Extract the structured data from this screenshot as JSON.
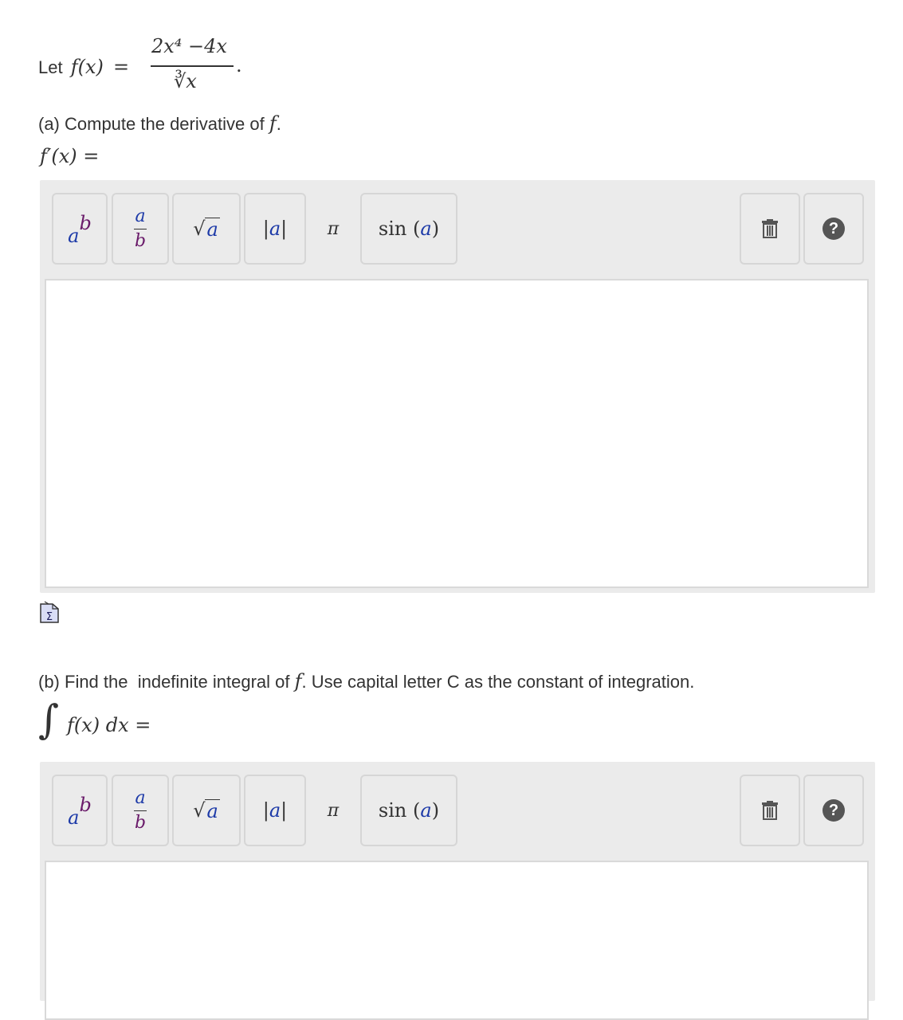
{
  "problem": {
    "let_label": "Let",
    "f_of_x": "f(x)",
    "equals": "=",
    "numerator": "2x⁴ −4x",
    "denominator": "∛x",
    "period": "."
  },
  "part_a": {
    "prompt_prefix": "(a) Compute the derivative of",
    "prompt_var": "f",
    "prompt_suffix": ".",
    "answer_label": "f′(x) ="
  },
  "part_b": {
    "prompt_prefix": "(b) Find the  indefinite integral of",
    "prompt_var": "f",
    "prompt_suffix": ". Use capital letter C as the constant of integration.",
    "integral_sign": "∫",
    "answer_label": "f(x) dx ="
  },
  "toolbar": {
    "power_base": "a",
    "power_exp": "b",
    "frac_num": "a",
    "frac_den": "b",
    "sqrt_symbol": "√",
    "sqrt_arg": "a",
    "abs_label": "|a|",
    "abs_arg": "a",
    "pi_label": "π",
    "sin_label": "sin",
    "sin_arg": "a",
    "help_label": "?"
  },
  "icons": {
    "equation_icon": "Σ",
    "trash": "trash-icon",
    "help": "help-icon"
  },
  "colors": {
    "panel_bg": "#ebebeb",
    "blue_var": "#1d3aa8",
    "purple_var": "#6a1b6a"
  }
}
